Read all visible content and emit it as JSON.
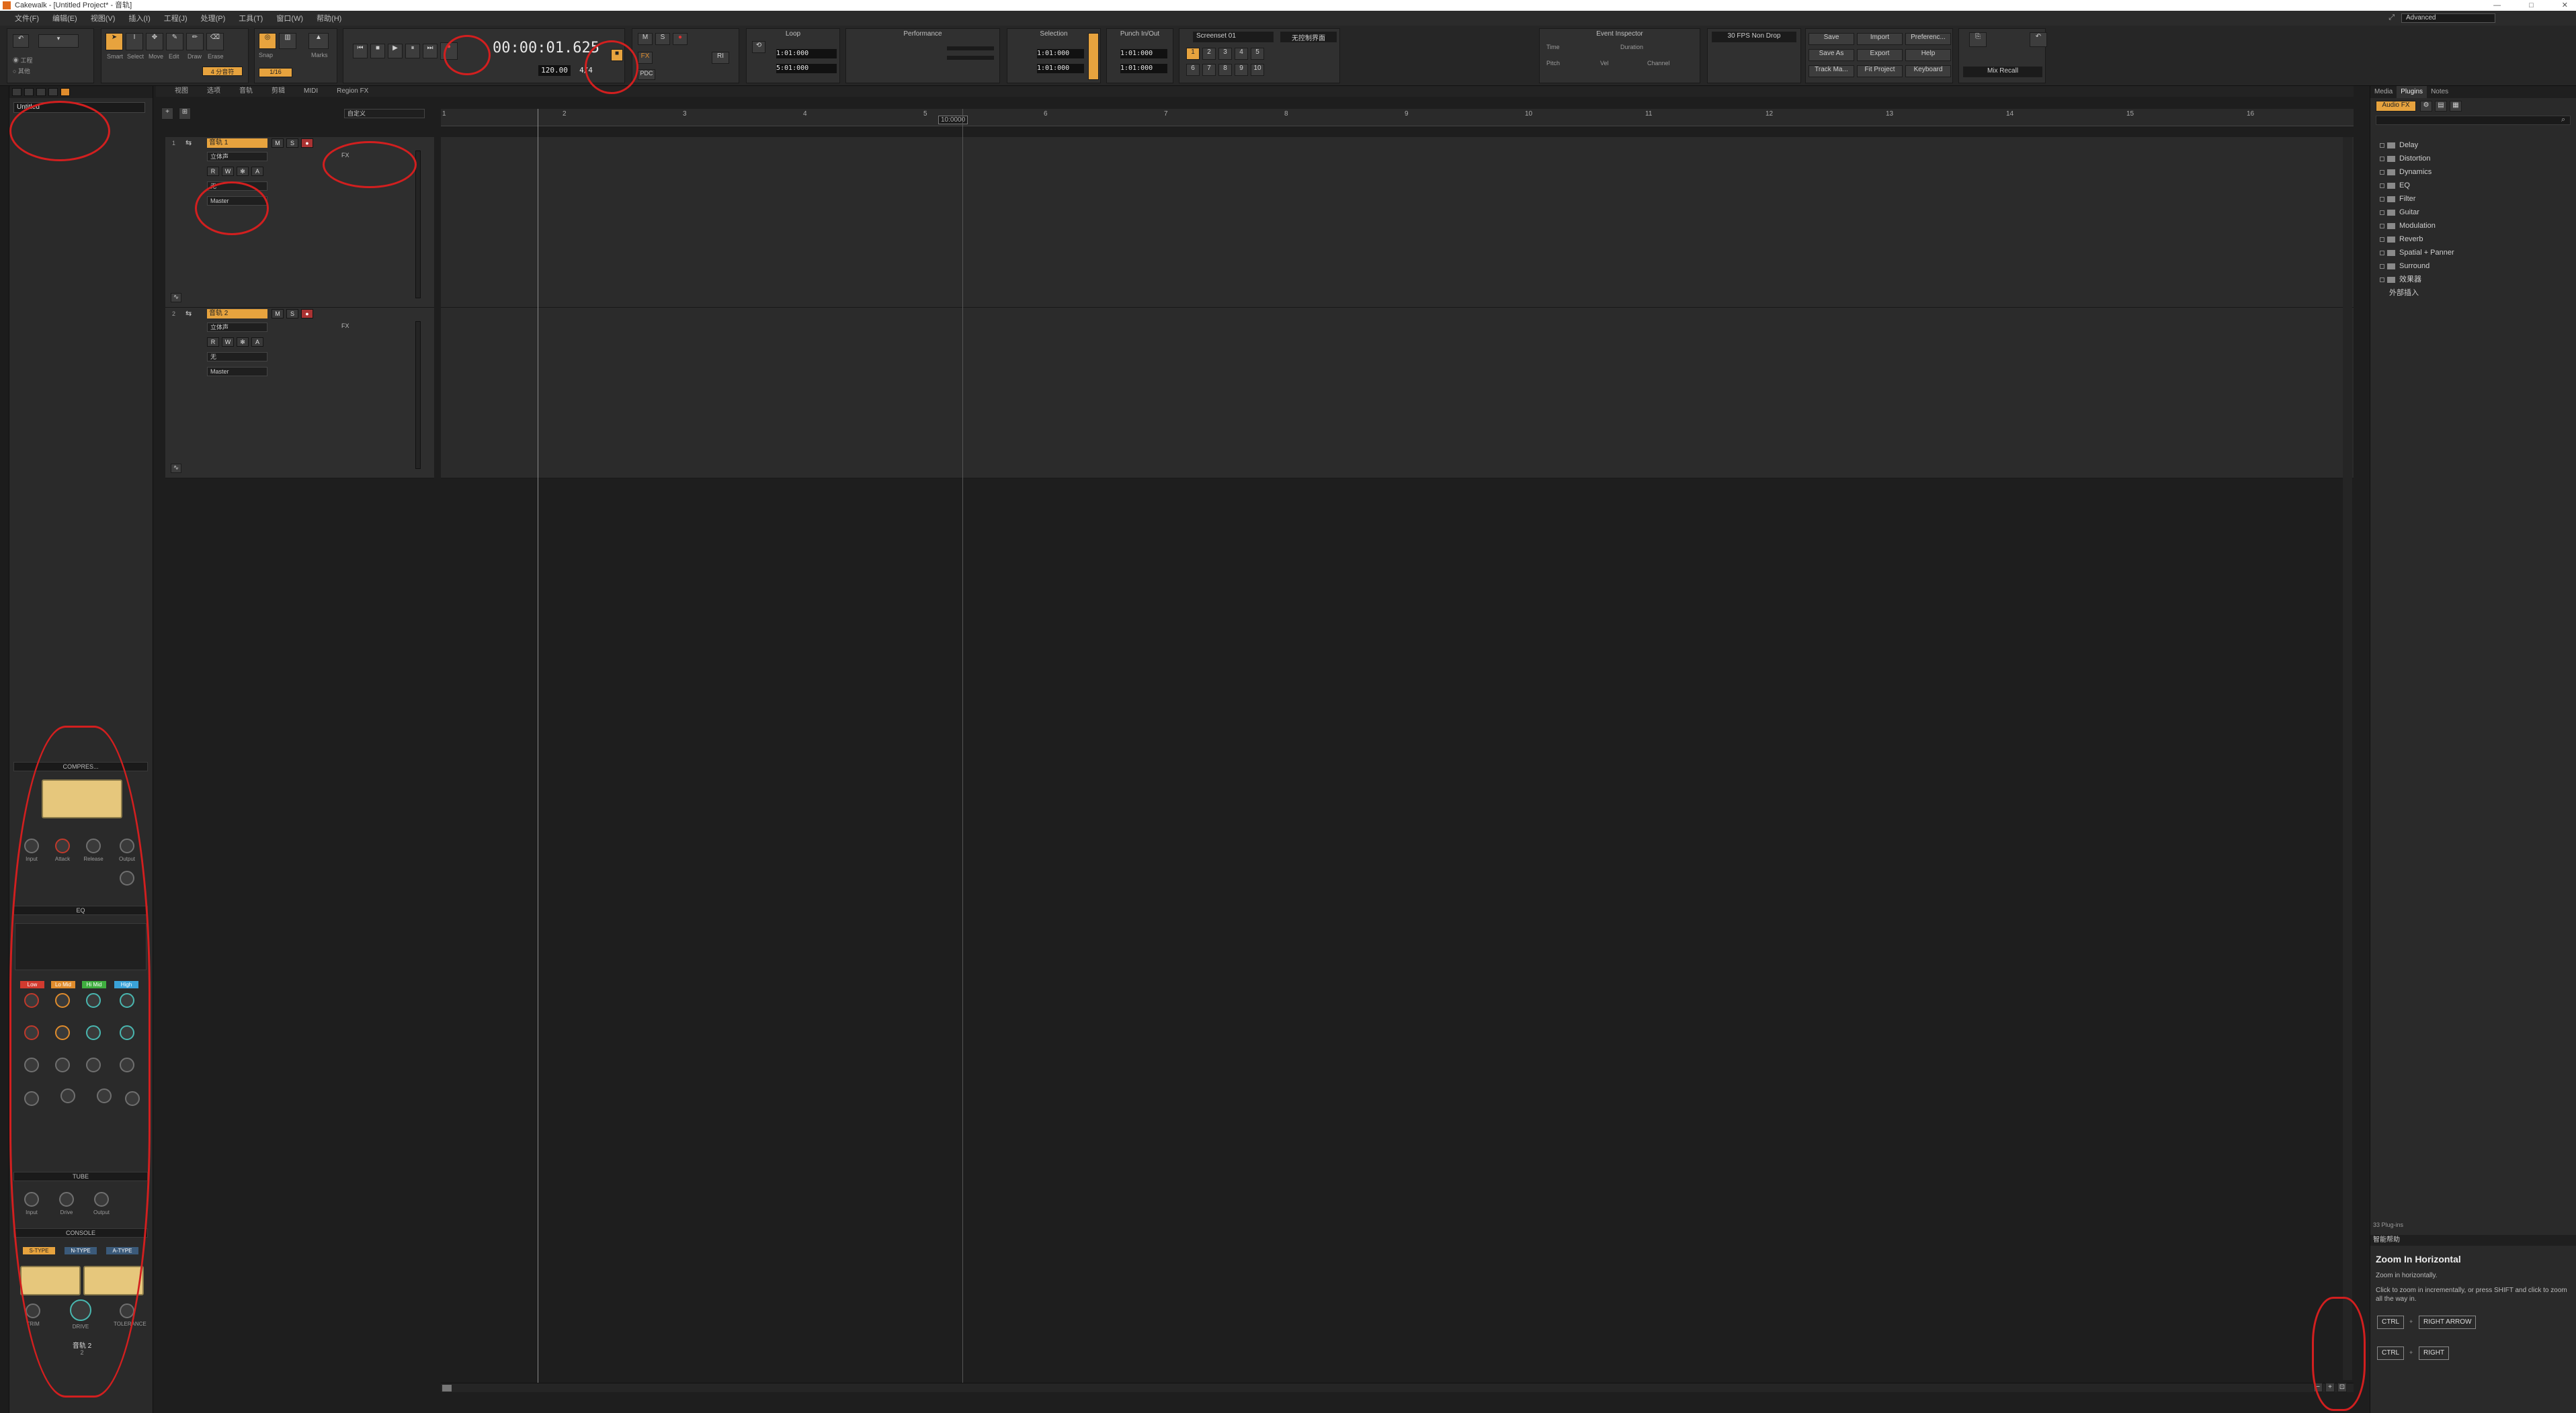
{
  "window": {
    "title": "Cakewalk - [Untitled Project* - 音轨]",
    "controls": [
      "—",
      "□",
      "✕"
    ]
  },
  "menu": {
    "items": [
      "文件(F)",
      "编辑(E)",
      "视图(V)",
      "插入(I)",
      "工程(J)",
      "处理(P)",
      "工具(T)",
      "窗口(W)",
      "帮助(H)"
    ],
    "workspace": "Advanced"
  },
  "controlbar": {
    "tools": [
      "Smart",
      "Select",
      "Move",
      "Edit",
      "Draw",
      "Erase"
    ],
    "snap": {
      "label": "Snap",
      "value": "1/16",
      "marks": "Marks",
      "quarter": "4 分音符"
    },
    "transport": {
      "time": "00:00:01.625",
      "tempo": "120.00",
      "meter": "4/4",
      "pdc": "PDC"
    },
    "loop": {
      "title": "Loop",
      "start": "1:01:000",
      "end": "5:01:000"
    },
    "performance": {
      "title": "Performance"
    },
    "selection": {
      "title": "Selection",
      "start": "1:01:000",
      "end": "1:01:000"
    },
    "punch": {
      "title": "Punch In/Out",
      "start": "1:01:000",
      "end": "1:01:000"
    },
    "screenset": {
      "title": "Screenset 01",
      "slots": [
        "1",
        "2",
        "3",
        "4",
        "5",
        "6",
        "7",
        "8",
        "9",
        "10"
      ]
    },
    "inspector_preset": "无控制界面",
    "event_inspector": {
      "title": "Event Inspector",
      "time": "Time",
      "duration": "Duration",
      "pitch": "Pitch",
      "vel": "Vel",
      "channel": "Channel"
    },
    "fps": "30 FPS Non Drop",
    "file_buttons": [
      "Save",
      "Import",
      "Preferenc...",
      "Save As",
      "Export",
      "Help",
      "Track Ma...",
      "Fit Project",
      "Keyboard"
    ],
    "mix": "Mix Recall"
  },
  "inspector": {
    "project_name": "Untitled",
    "modules": {
      "compressor": "COMPRES...",
      "compressor_knobs": [
        "Input",
        "Attack",
        "Release",
        "Output"
      ],
      "eq": "EQ",
      "eq_bands": [
        {
          "label": "Low",
          "color": "#d23a2f"
        },
        {
          "label": "Lo Mid",
          "color": "#e08c2c"
        },
        {
          "label": "Hi Mid",
          "color": "#3fae3f"
        },
        {
          "label": "High",
          "color": "#3aa2d8"
        }
      ],
      "tube": "TUBE",
      "tube_knobs": [
        "Input",
        "Drive",
        "Output"
      ],
      "console": "CONSOLE",
      "console_types": [
        "S-TYPE",
        "N-TYPE",
        "A-TYPE"
      ],
      "console_knobs": [
        "TRIM",
        "DRIVE",
        "TOLERANCE"
      ],
      "strip_name": "音轨 2",
      "strip_num": "2"
    }
  },
  "trackview": {
    "menu": [
      "视图",
      "选项",
      "音轨",
      "剪辑",
      "MIDI",
      "Region FX"
    ],
    "custom": "自定义",
    "ruler": [
      "1",
      "2",
      "3",
      "4",
      "5",
      "6",
      "7",
      "8",
      "9",
      "10",
      "11",
      "12",
      "13",
      "14",
      "15",
      "16"
    ],
    "marker": "10:0000",
    "tracks": [
      {
        "num": "1",
        "name": "音轨 1",
        "input": "无",
        "output": "Master",
        "mode": "立体声",
        "fx": "FX",
        "selected": true
      },
      {
        "num": "2",
        "name": "音轨 2",
        "input": "无",
        "output": "Master",
        "mode": "立体声",
        "fx": "FX",
        "selected": false
      }
    ]
  },
  "browser": {
    "tabs": [
      "Media",
      "Plugins",
      "Notes"
    ],
    "audio_fx": "Audio FX",
    "folders": [
      "Delay",
      "Distortion",
      "Dynamics",
      "EQ",
      "Filter",
      "Guitar",
      "Modulation",
      "Reverb",
      "Spatial + Panner",
      "Surround",
      "效果器",
      "外部插入"
    ],
    "count": "33 Plug-ins",
    "help_header": "智能帮助",
    "help": {
      "title": "Zoom In Horizontal",
      "line1": "Zoom in horizontally.",
      "line2": "Click to zoom in incrementally, or press SHIFT and click to zoom all the way in.",
      "k1a": "CTRL",
      "k1b": "RIGHT ARROW",
      "k2a": "CTRL",
      "k2b": "RIGHT"
    }
  }
}
